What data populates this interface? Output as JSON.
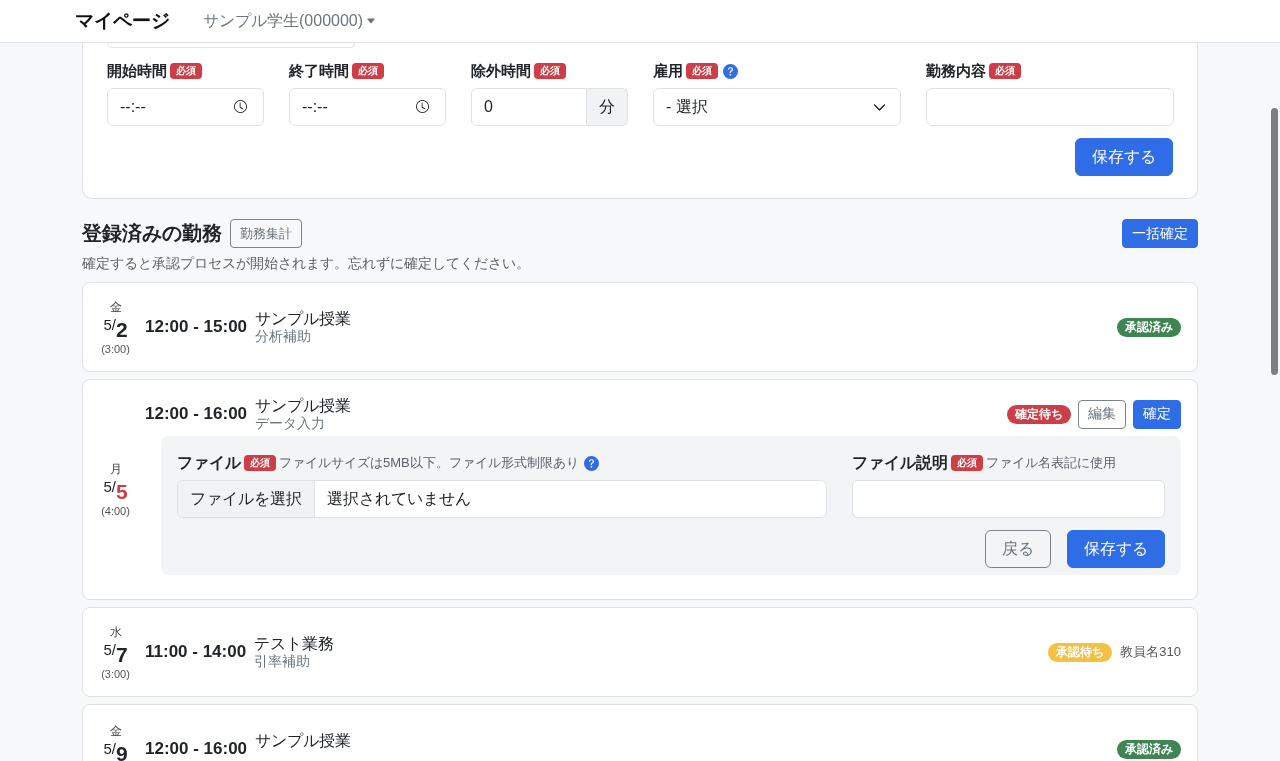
{
  "header": {
    "title": "マイページ",
    "user_menu": "サンプル学生(000000)"
  },
  "form": {
    "fields": [
      {
        "kind": "time",
        "label": "開始時間",
        "required": "必須",
        "placeholder": "--:--"
      },
      {
        "kind": "time",
        "label": "終了時間",
        "required": "必須",
        "placeholder": "--:--"
      },
      {
        "kind": "number",
        "label": "除外時間",
        "required": "必須",
        "value": "0",
        "unit": "分"
      },
      {
        "kind": "select",
        "label": "雇用",
        "required": "必須",
        "help": true,
        "value": "- 選択"
      },
      {
        "kind": "text",
        "label": "勤務内容",
        "required": "必須"
      }
    ],
    "submit": "保存する"
  },
  "section": {
    "title": "登録済みの勤務",
    "summary_button": "勤務集計",
    "bulk_confirm": "一括確定",
    "note": "確定すると承認プロセスが開始されます。忘れずに確定してください。"
  },
  "records": [
    {
      "weekday": "金",
      "month": "5/",
      "day": "2",
      "duration": "(3:00)",
      "highlighted": false,
      "time": "12:00 - 15:00",
      "title": "サンプル授業",
      "detail": "分析補助",
      "status": {
        "label": "承認済み",
        "color": "#3e8553"
      }
    },
    {
      "weekday": "月",
      "month": "5/",
      "day": "5",
      "duration": "(4:00)",
      "highlighted": true,
      "time": "12:00 - 16:00",
      "title": "サンプル授業",
      "detail": "データ入力",
      "status": {
        "label": "確定待ち",
        "color": "#cf3d46"
      },
      "actions": [
        {
          "label": "編集",
          "kind": "outline"
        },
        {
          "label": "確定",
          "kind": "primary"
        }
      ],
      "upload": {
        "file": {
          "label": "ファイル",
          "required": "必須",
          "hint": "ファイルサイズは5MB以下。ファイル形式制限あり",
          "help": true,
          "button": "ファイルを選択",
          "value": "選択されていません"
        },
        "description": {
          "label": "ファイル説明",
          "required": "必須",
          "hint": "ファイル名表記に使用"
        },
        "buttons": [
          {
            "label": "戻る",
            "kind": "outline"
          },
          {
            "label": "保存する",
            "kind": "primary"
          }
        ]
      }
    },
    {
      "weekday": "水",
      "month": "5/",
      "day": "7",
      "duration": "(3:00)",
      "highlighted": false,
      "time": "11:00 - 14:00",
      "title": "テスト業務",
      "detail": "引率補助",
      "status": {
        "label": "承認待ち",
        "color": "#f4c144"
      },
      "teacher": "教員名310"
    },
    {
      "weekday": "金",
      "month": "5/",
      "day": "9",
      "highlighted": false,
      "time": "12:00 - 16:00",
      "title": "サンプル授業",
      "status": {
        "label": "承認済み",
        "color": "#3e8553"
      }
    }
  ]
}
